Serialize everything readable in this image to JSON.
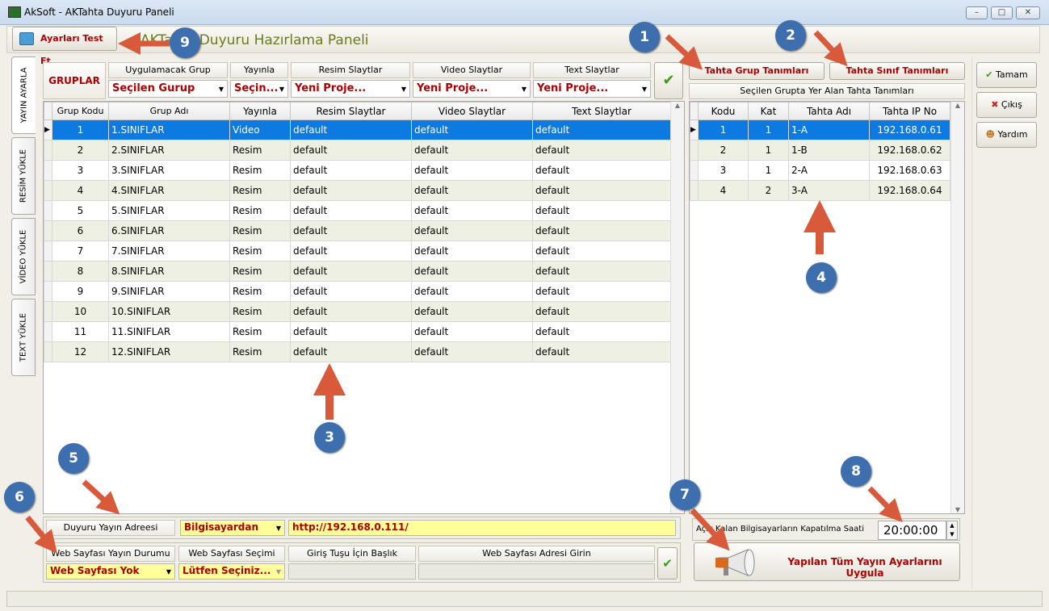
{
  "window": {
    "title": "AkSoft - AKTahta Duyuru Paneli"
  },
  "toolbar": {
    "test_button": "Ayarları Test Et",
    "panel_title": "AKTahta Duyuru Hazırlama Paneli"
  },
  "tabs": [
    "YAYIN AYARLA",
    "RESİM YÜKLE",
    "VİDEO YÜKLE",
    "TEXT YÜKLE"
  ],
  "filters": {
    "gruplar_label": "GRUPLAR",
    "headers": [
      "Uygulamacak Grup",
      "Yayınla",
      "Resim Slaytlar",
      "Video Slaytlar",
      "Text Slaytlar"
    ],
    "values": [
      "Seçilen Gurup",
      "Seçin...",
      "Yeni Proje...",
      "Yeni Proje...",
      "Yeni Proje..."
    ]
  },
  "groups_table": {
    "columns": [
      "Grup Kodu",
      "Grup Adı",
      "Yayınla",
      "Resim Slaytlar",
      "Video Slaytlar",
      "Text Slaytlar"
    ],
    "rows": [
      [
        "1",
        "1.SINIFLAR",
        "Video",
        "default",
        "default",
        "default"
      ],
      [
        "2",
        "2.SINIFLAR",
        "Resim",
        "default",
        "default",
        "default"
      ],
      [
        "3",
        "3.SINIFLAR",
        "Resim",
        "default",
        "default",
        "default"
      ],
      [
        "4",
        "4.SINIFLAR",
        "Resim",
        "default",
        "default",
        "default"
      ],
      [
        "5",
        "5.SINIFLAR",
        "Resim",
        "default",
        "default",
        "default"
      ],
      [
        "6",
        "6.SINIFLAR",
        "Resim",
        "default",
        "default",
        "default"
      ],
      [
        "7",
        "7.SINIFLAR",
        "Resim",
        "default",
        "default",
        "default"
      ],
      [
        "8",
        "8.SINIFLAR",
        "Resim",
        "default",
        "default",
        "default"
      ],
      [
        "9",
        "9.SINIFLAR",
        "Resim",
        "default",
        "default",
        "default"
      ],
      [
        "10",
        "10.SINIFLAR",
        "Resim",
        "default",
        "default",
        "default"
      ],
      [
        "11",
        "11.SINIFLAR",
        "Resim",
        "default",
        "default",
        "default"
      ],
      [
        "12",
        "12.SINIFLAR",
        "Resim",
        "default",
        "default",
        "default"
      ]
    ]
  },
  "right_panel": {
    "grup_button": "Tahta Grup Tanımları",
    "sinif_button": "Tahta Sınıf Tanımları",
    "subtitle": "Seçilen Grupta Yer Alan Tahta Tanımları",
    "columns": [
      "Kodu",
      "Kat",
      "Tahta Adı",
      "Tahta IP No"
    ],
    "rows": [
      [
        "1",
        "1",
        "1-A",
        "192.168.0.61"
      ],
      [
        "2",
        "1",
        "1-B",
        "192.168.0.62"
      ],
      [
        "3",
        "1",
        "2-A",
        "192.168.0.63"
      ],
      [
        "4",
        "2",
        "3-A",
        "192.168.0.64"
      ]
    ]
  },
  "side_buttons": [
    "Tamam",
    "Çıkış",
    "Yardım"
  ],
  "bottom": {
    "yayin_adresi_label": "Duyuru Yayın Adreesi",
    "source_value": "Bilgisayardan",
    "address_value": "http://192.168.0.111/",
    "headers": [
      "Web Sayfası Yayın Durumu",
      "Web Sayfası Seçimi",
      "Giriş Tuşu İçin Başlık",
      "Web Sayfası Adresi Girin"
    ],
    "durum_value": "Web Sayfası Yok",
    "secim_value": "Lütfen Seçiniz..."
  },
  "shutdown": {
    "label": "Açık Kalan Bilgisayarların Kapatılma Saati",
    "time": "20:00:00"
  },
  "apply_button": "Yapılan Tüm Yayın Ayarlarını Uygula",
  "markers": [
    "1",
    "2",
    "3",
    "4",
    "5",
    "6",
    "7",
    "8",
    "9"
  ],
  "colors": {
    "selection": "#0c7ae0",
    "marker": "#3d6fae",
    "arrow": "#d95a3a",
    "accent_red": "#b00000"
  }
}
